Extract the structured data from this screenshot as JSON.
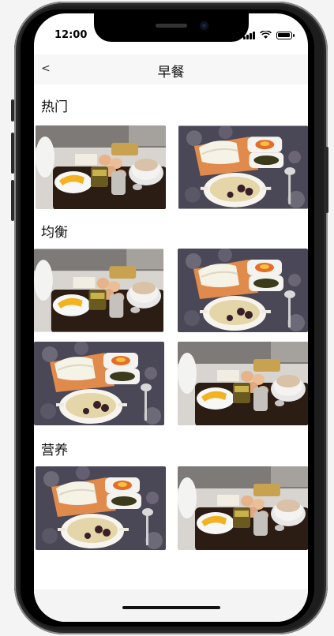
{
  "status_bar": {
    "time": "12:00"
  },
  "nav": {
    "back_label": "<",
    "title": "早餐"
  },
  "sections": [
    {
      "title": "热门",
      "photos": [
        "food-photo-tray-tea",
        "food-photo-buns-porridge"
      ]
    },
    {
      "title": "均衡",
      "photos": [
        "food-photo-tray-tea",
        "food-photo-buns-porridge",
        "food-photo-buns-porridge",
        "food-photo-tray-tea"
      ]
    },
    {
      "title": "营养",
      "photos": [
        "food-photo-buns-porridge",
        "food-photo-tray-tea"
      ]
    }
  ],
  "colors": {
    "tray": "#2b1c14",
    "orange_tray": "#e08a4b",
    "background": "#ffffff",
    "nav": "#f7f7f7"
  }
}
